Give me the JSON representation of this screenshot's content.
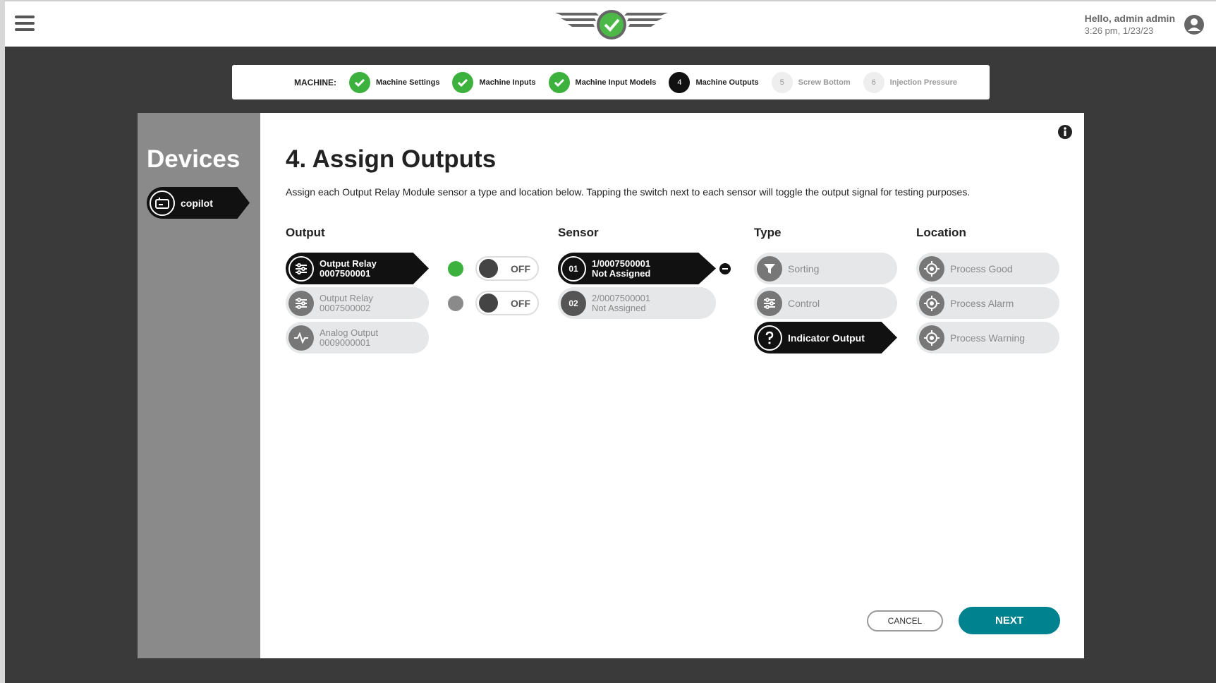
{
  "header": {
    "greeting": "Hello, admin admin",
    "timestamp": "3:26 pm, 1/23/23"
  },
  "stepper": {
    "label": "MACHINE:",
    "steps": [
      {
        "label": "Machine Settings",
        "state": "done",
        "number": ""
      },
      {
        "label": "Machine Inputs",
        "state": "done",
        "number": ""
      },
      {
        "label": "Machine Input Models",
        "state": "done",
        "number": ""
      },
      {
        "label": "Machine Outputs",
        "state": "active",
        "number": "4"
      },
      {
        "label": "Screw Bottom",
        "state": "todo",
        "number": "5"
      },
      {
        "label": "Injection Pressure",
        "state": "todo",
        "number": "6"
      }
    ]
  },
  "sidebar": {
    "title": "Devices",
    "device": "copilot"
  },
  "main": {
    "title": "4. Assign Outputs",
    "description": "Assign each Output Relay Module sensor a type and location below. Tapping the switch next to each sensor will toggle the output signal for testing purposes.",
    "columns": {
      "output": "Output",
      "sensor": "Sensor",
      "type": "Type",
      "location": "Location"
    },
    "outputs": [
      {
        "name": "Output Relay",
        "id": "0007500001",
        "selected": true,
        "icon": "relay-icon"
      },
      {
        "name": "Output Relay",
        "id": "0007500002",
        "selected": false,
        "icon": "relay-icon"
      },
      {
        "name": "Analog Output",
        "id": "0009000001",
        "selected": false,
        "icon": "waveform-icon"
      }
    ],
    "toggles": [
      {
        "state": "OFF",
        "led_color": "#3db13d"
      },
      {
        "state": "OFF",
        "led_color": "#8a8a8a"
      }
    ],
    "sensors": [
      {
        "num": "01",
        "id": "1/0007500001",
        "status": "Not Assigned",
        "selected": true
      },
      {
        "num": "02",
        "id": "2/0007500001",
        "status": "Not Assigned",
        "selected": false
      }
    ],
    "types": [
      {
        "label": "Sorting",
        "icon": "filter-icon",
        "selected": false
      },
      {
        "label": "Control",
        "icon": "sliders-icon",
        "selected": false
      },
      {
        "label": "Indicator Output",
        "icon": "question-icon",
        "selected": true
      }
    ],
    "locations": [
      {
        "label": "Process Good",
        "icon": "target-icon"
      },
      {
        "label": "Process Alarm",
        "icon": "target-icon"
      },
      {
        "label": "Process Warning",
        "icon": "target-icon"
      }
    ],
    "buttons": {
      "cancel": "CANCEL",
      "next": "NEXT"
    }
  },
  "colors": {
    "accent": "#00838f",
    "success": "#3db13d",
    "sidebar": "#8a8a8a",
    "background": "#3a3a3a"
  }
}
